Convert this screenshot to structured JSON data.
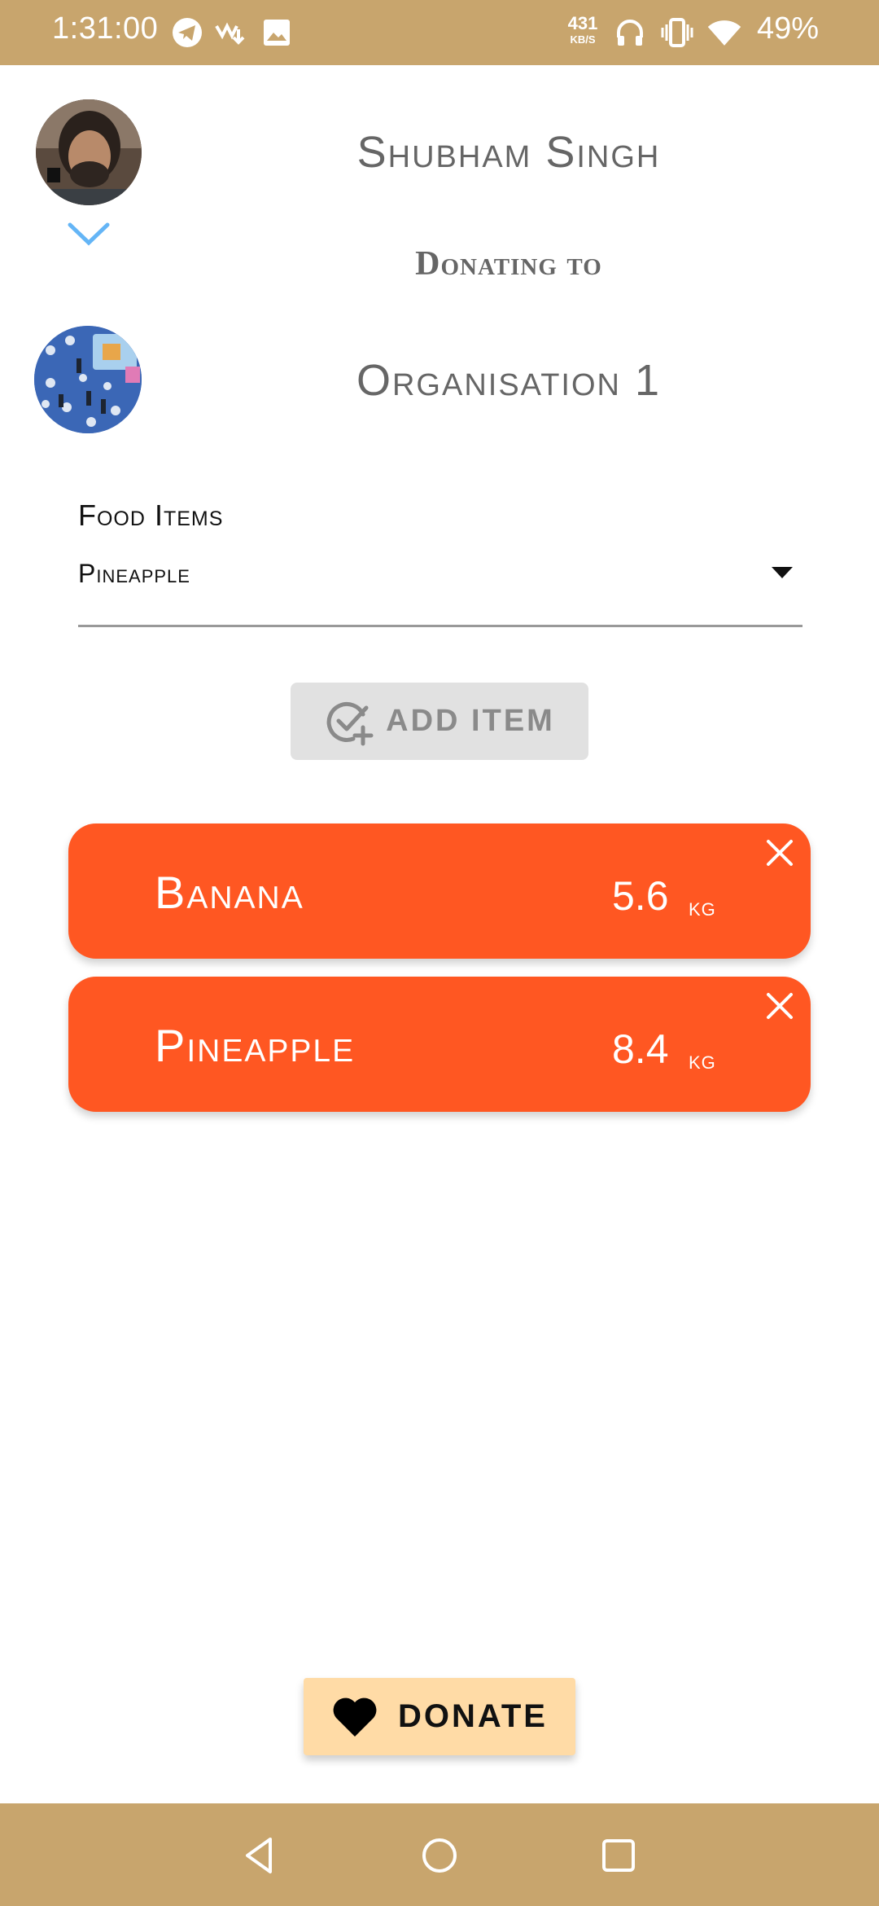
{
  "status_bar": {
    "time": "1:31:00",
    "net_speed_value": "431",
    "net_speed_unit": "KB/S",
    "battery": "49%",
    "icons": [
      "telegram-icon",
      "call-forwarding-icon",
      "image-icon",
      "headphones-icon",
      "vibrate-icon",
      "wifi-icon"
    ]
  },
  "donor": {
    "name": "Shubham Singh"
  },
  "donating_to_label": "Donating to",
  "organisation": {
    "name": "Organisation 1"
  },
  "food_field": {
    "label": "Food Items",
    "selected": "Pineapple"
  },
  "add_item_label": "ADD ITEM",
  "items": [
    {
      "name": "Banana",
      "quantity": "5.6",
      "unit": "kg"
    },
    {
      "name": "Pineapple",
      "quantity": "8.4",
      "unit": "kg"
    }
  ],
  "donate_label": "DONATE",
  "colors": {
    "bar": "#c8a56d",
    "item_card": "#ff5722",
    "donate_button": "#ffdba6",
    "chevron": "#64b5f6"
  }
}
